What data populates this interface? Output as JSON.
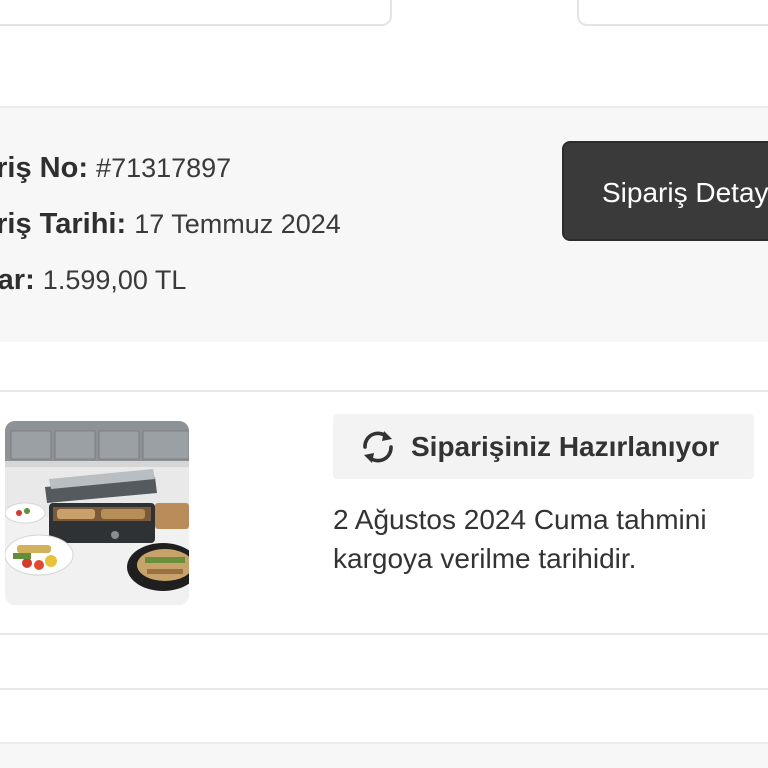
{
  "order": {
    "number_label": "ariş No:",
    "number_value": "#71317897",
    "date_label": "ariş Tarihi:",
    "date_value": "17 Temmuz 2024",
    "total_label": "tar:",
    "total_value": "1.599,00 TL",
    "detail_button_label": "Sipariş Detay"
  },
  "shipment": {
    "status_label": "Siparişiniz Hazırlanıyor",
    "status_icon": "refresh-icon",
    "eta_text": "2 Ağustos 2024 Cuma tahmini kargoya verilme tarihidir."
  },
  "colors": {
    "button_bg": "#3a3a3a",
    "band_bg": "#f7f7f7",
    "status_bg": "#f3f3f3"
  }
}
